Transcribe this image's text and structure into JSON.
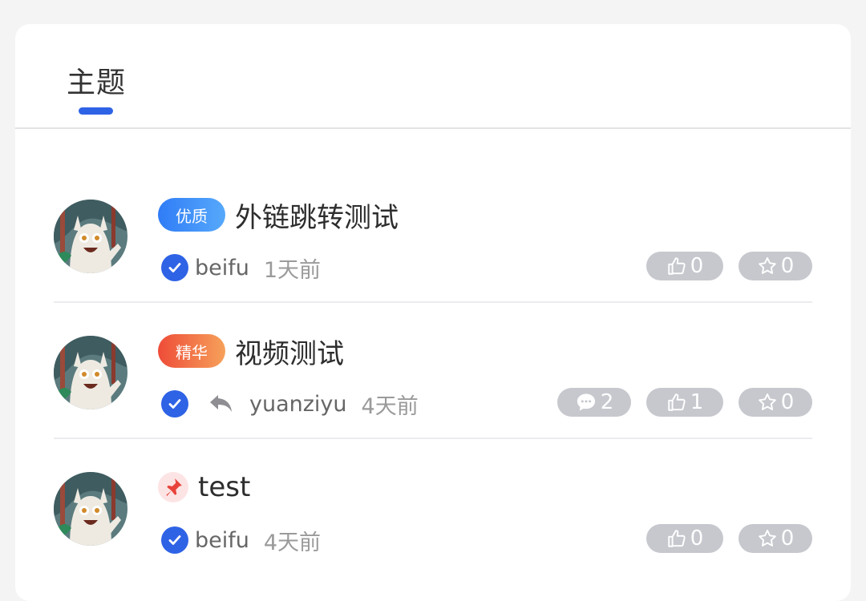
{
  "tab": {
    "label": "主题"
  },
  "colors": {
    "accent": "#2f63e6",
    "stat_bg": "#c6c8ce"
  },
  "posts": [
    {
      "tag": "优质",
      "title": "外链跳转测试",
      "author": "beifu",
      "time": "1天前",
      "likes": "0",
      "favorites": "0"
    },
    {
      "tag": "精华",
      "title": "视频测试",
      "author": "yuanziyu",
      "time": "4天前",
      "comments": "2",
      "likes": "1",
      "favorites": "0"
    },
    {
      "title": "test",
      "author": "beifu",
      "time": "4天前",
      "likes": "0",
      "favorites": "0"
    }
  ]
}
